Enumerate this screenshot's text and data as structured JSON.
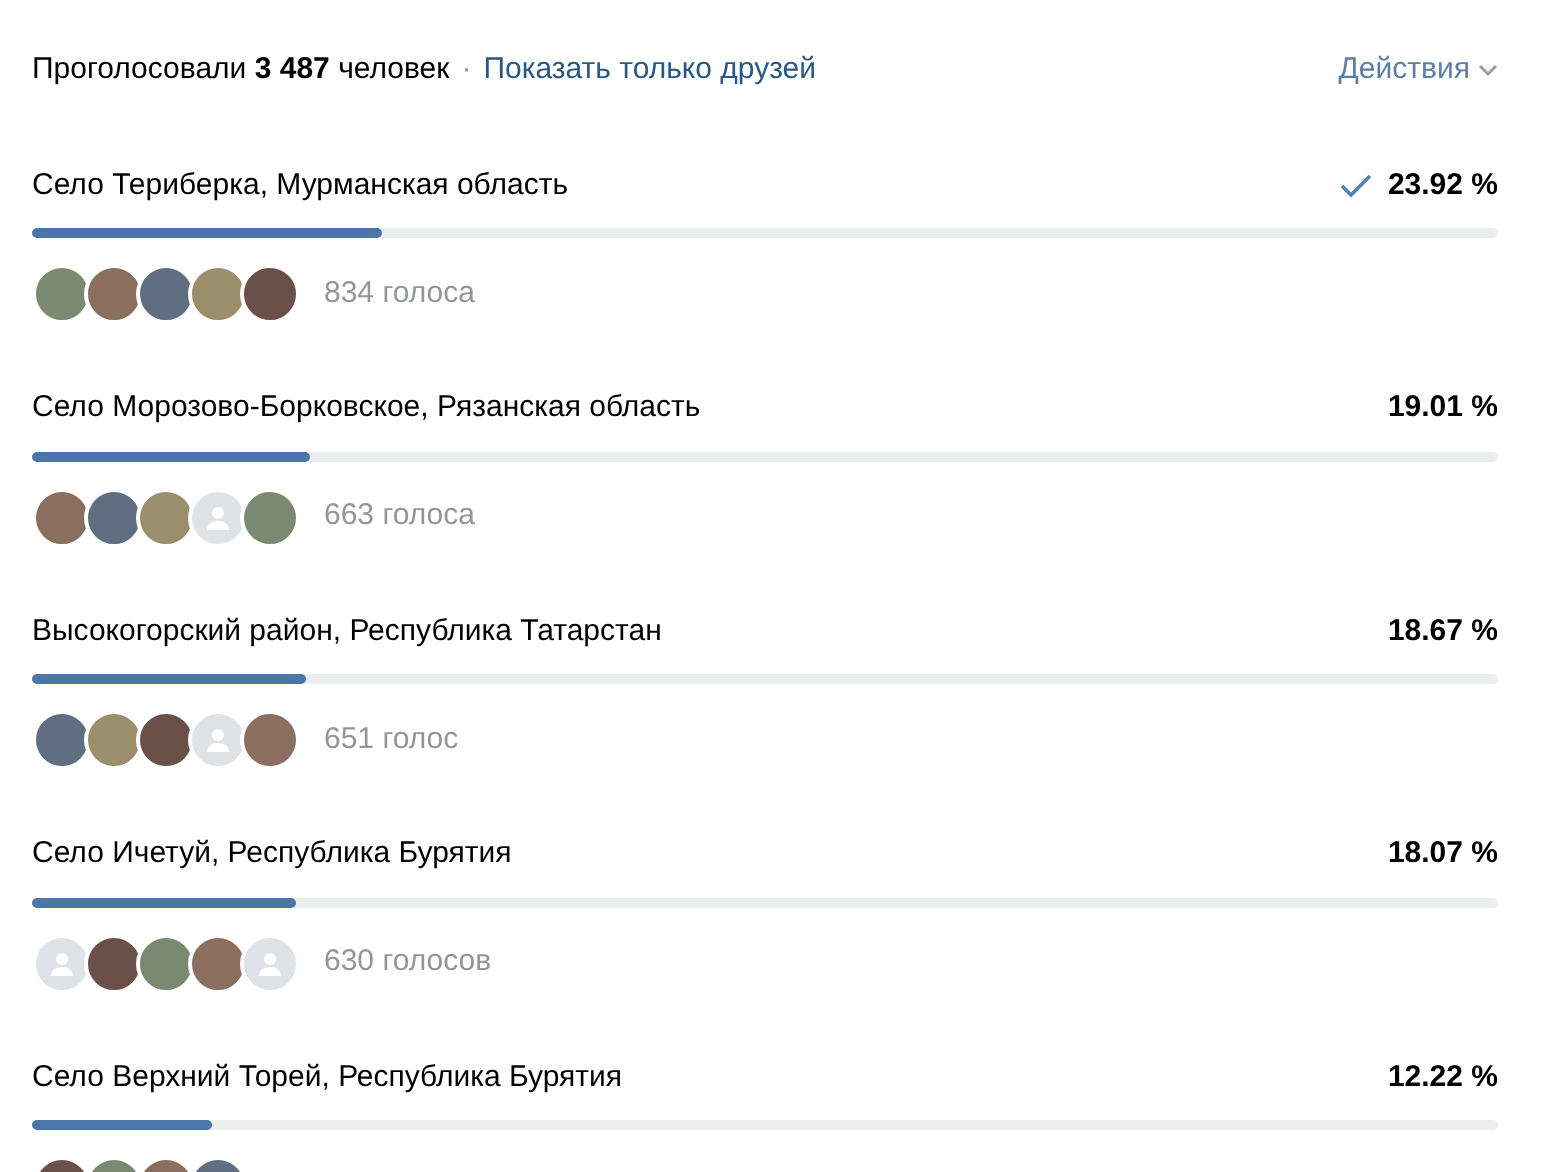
{
  "header": {
    "voted_label": "Проголосовали",
    "count": "3 487",
    "people_label": "человек",
    "separator": "·",
    "friends_link": "Показать только друзей",
    "actions": "Действия"
  },
  "options": [
    {
      "title": "Село Териберка, Мурманская область",
      "percent": "23.92 %",
      "level": 0.2392,
      "voted": true,
      "votes": "834 голоса",
      "avatars": [
        {
          "kind": "photo"
        },
        {
          "kind": "photo"
        },
        {
          "kind": "photo"
        },
        {
          "kind": "photo"
        },
        {
          "kind": "photo"
        }
      ]
    },
    {
      "title": "Село Морозово-Борковское, Рязанская область",
      "percent": "19.01 %",
      "level": 0.1901,
      "voted": false,
      "votes": "663 голоса",
      "avatars": [
        {
          "kind": "photo"
        },
        {
          "kind": "photo"
        },
        {
          "kind": "photo"
        },
        {
          "kind": "placeholder"
        },
        {
          "kind": "photo"
        }
      ]
    },
    {
      "title": "Высокогорский район, Республика Татарстан",
      "percent": "18.67 %",
      "level": 0.1867,
      "voted": false,
      "votes": "651 голос",
      "avatars": [
        {
          "kind": "photo"
        },
        {
          "kind": "photo"
        },
        {
          "kind": "photo"
        },
        {
          "kind": "placeholder"
        },
        {
          "kind": "photo"
        }
      ]
    },
    {
      "title": "Село Ичетуй, Республика Бурятия",
      "percent": "18.07 %",
      "level": 0.1807,
      "voted": false,
      "votes": "630 голосов",
      "avatars": [
        {
          "kind": "placeholder"
        },
        {
          "kind": "photo"
        },
        {
          "kind": "photo"
        },
        {
          "kind": "photo"
        },
        {
          "kind": "placeholder"
        }
      ]
    },
    {
      "title": "Село Верхний Торей, Республика Бурятия",
      "percent": "12.22 %",
      "level": 0.1222,
      "voted": false,
      "avatars": [
        {
          "kind": "photo"
        },
        {
          "kind": "photo"
        },
        {
          "kind": "photo"
        },
        {
          "kind": "photo"
        }
      ]
    }
  ]
}
